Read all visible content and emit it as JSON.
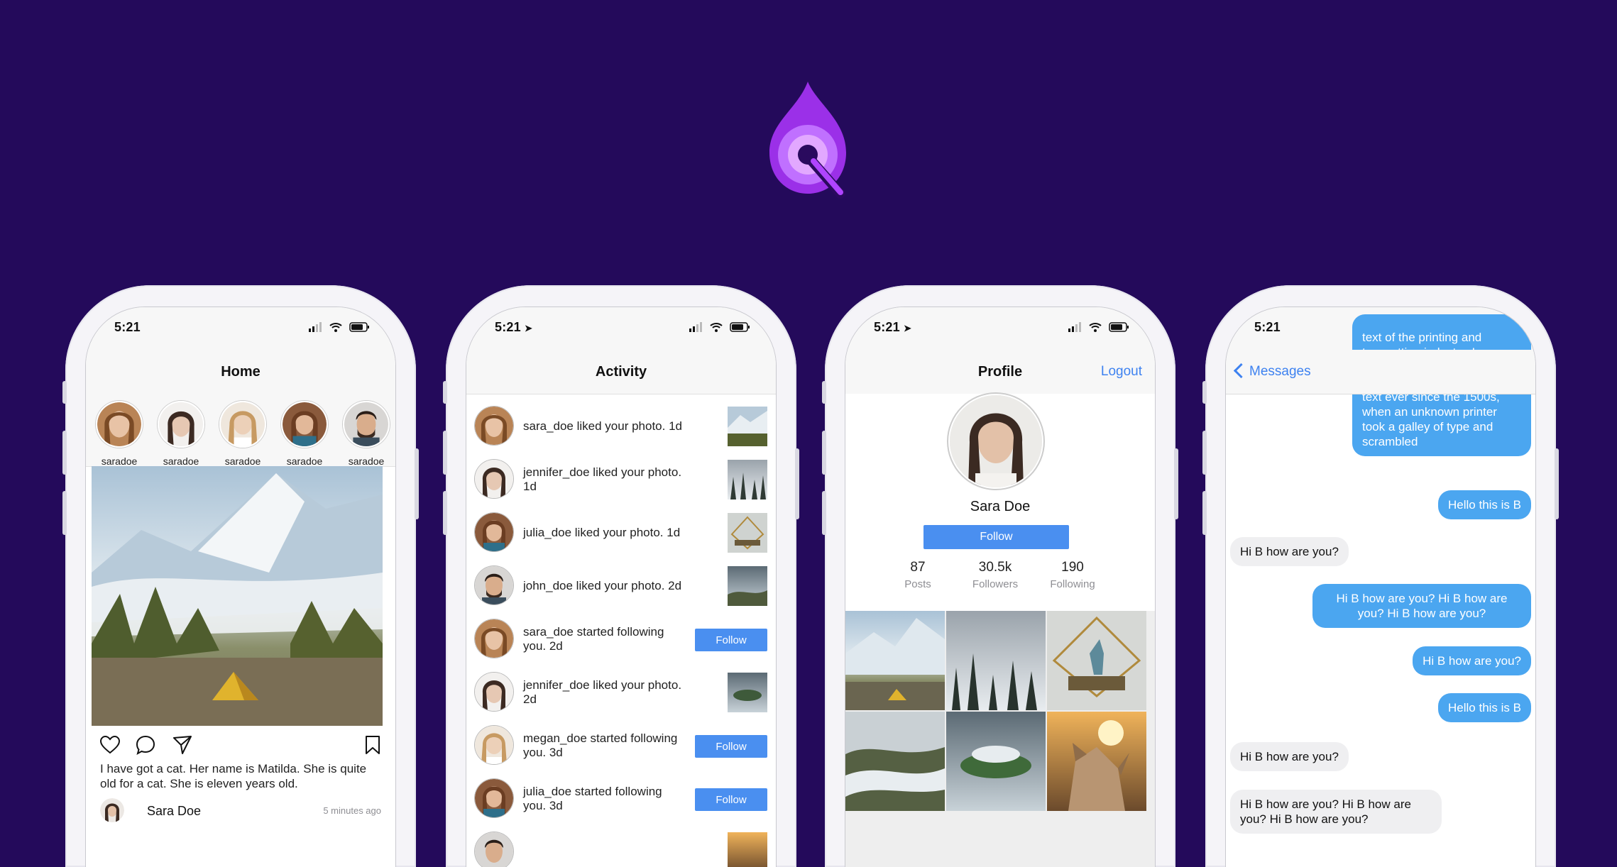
{
  "colors": {
    "background": "#240a5b",
    "accent": "#4a8ff0",
    "bubble_out": "#4ba6f0",
    "bubble_in": "#efeff1",
    "logo": "#b044ff"
  },
  "home": {
    "time": "5:21",
    "title": "Home",
    "stories": [
      {
        "name": "saradoe"
      },
      {
        "name": "saradoe"
      },
      {
        "name": "saradoe"
      },
      {
        "name": "saradoe"
      },
      {
        "name": "saradoe"
      }
    ],
    "post": {
      "caption": "I have got a cat. Her name is Matilda. She is quite old for a cat. She is eleven years old.",
      "author": "Sara Doe",
      "timestamp": "5 minutes ago"
    }
  },
  "activity": {
    "time": "5:21",
    "title": "Activity",
    "items": [
      {
        "text": "sara_doe liked your photo. 1d",
        "kind": "thumb"
      },
      {
        "text": "jennifer_doe liked your photo. 1d",
        "kind": "thumb"
      },
      {
        "text": "julia_doe liked your photo. 1d",
        "kind": "thumb"
      },
      {
        "text": "john_doe liked your photo. 2d",
        "kind": "thumb"
      },
      {
        "text": "sara_doe started following you. 2d",
        "kind": "follow",
        "button": "Follow"
      },
      {
        "text": "jennifer_doe liked your photo. 2d",
        "kind": "thumb"
      },
      {
        "text": "megan_doe started following you. 3d",
        "kind": "follow",
        "button": "Follow"
      },
      {
        "text": "julia_doe started following you. 3d",
        "kind": "follow",
        "button": "Follow"
      }
    ]
  },
  "profile": {
    "time": "5:21",
    "title": "Profile",
    "logout": "Logout",
    "name": "Sara Doe",
    "follow_button": "Follow",
    "stats": [
      {
        "value": "87",
        "label": "Posts"
      },
      {
        "value": "30.5k",
        "label": "Followers"
      },
      {
        "value": "190",
        "label": "Following"
      }
    ]
  },
  "chat": {
    "time": "5:21",
    "back_label": "Messages",
    "messages": [
      {
        "from": "me",
        "text": "text of the printing and typesetting industry. Lorem Ipsum has been the industry's standard dummy text ever since the 1500s, when an unknown printer took a galley of type and scrambled"
      },
      {
        "from": "me",
        "text": "Hello this is B"
      },
      {
        "from": "them",
        "text": "Hi B how are you?"
      },
      {
        "from": "me",
        "text": "Hi B how are you? Hi B how are you? Hi B how are you?"
      },
      {
        "from": "me",
        "text": "Hi B how are you?"
      },
      {
        "from": "me",
        "text": "Hello this is B"
      },
      {
        "from": "them",
        "text": "Hi B how are you?"
      },
      {
        "from": "them",
        "text": "Hi B how are you? Hi B how are you? Hi B how are you?"
      }
    ]
  }
}
